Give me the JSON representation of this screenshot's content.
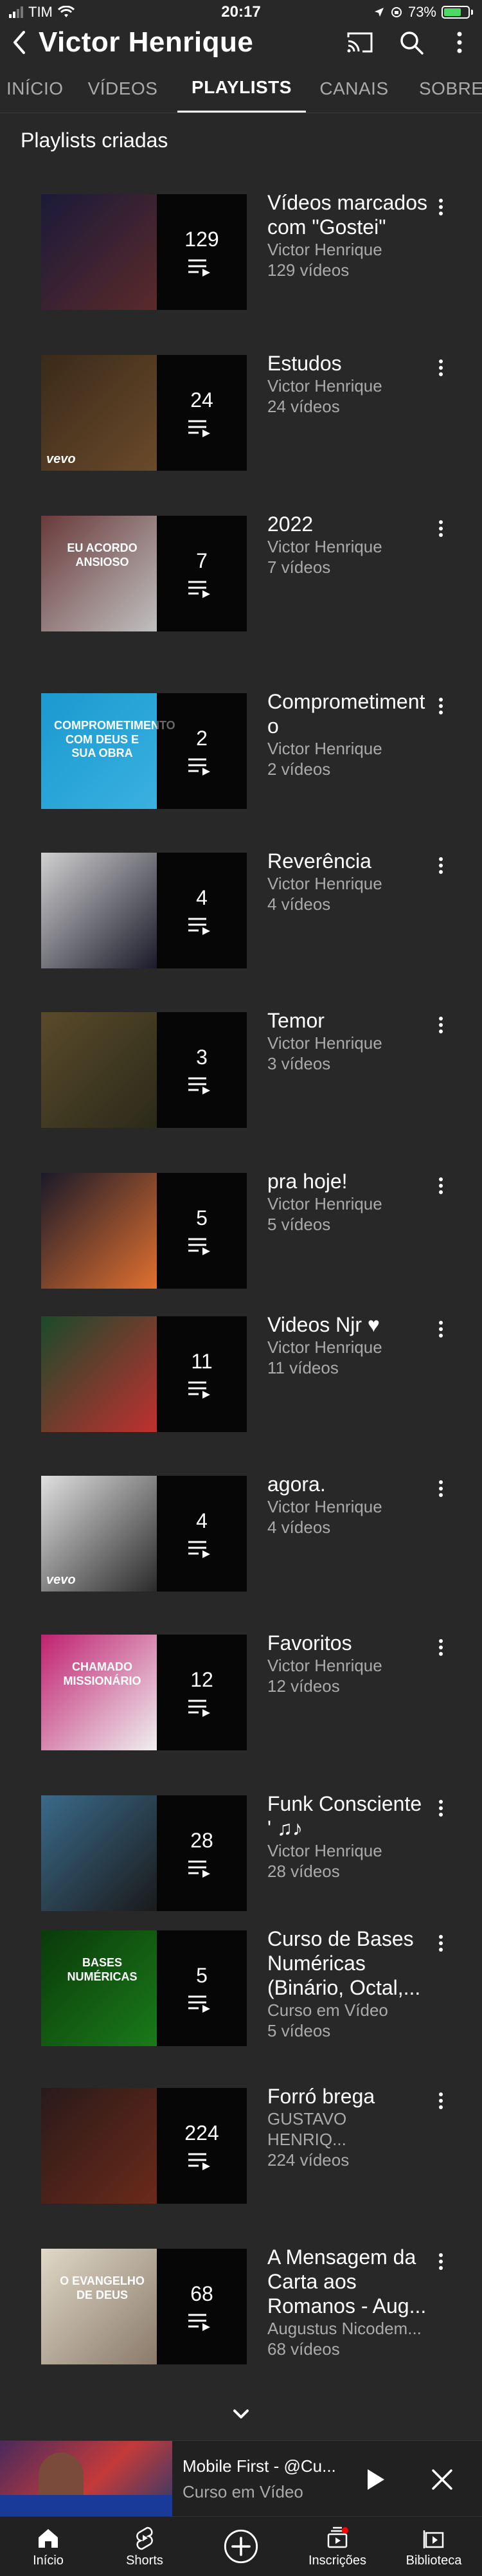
{
  "status_bar": {
    "carrier": "TIM",
    "time": "20:17",
    "battery": "73%"
  },
  "header": {
    "title": "Victor Henrique"
  },
  "tabs": [
    {
      "label": "INÍCIO"
    },
    {
      "label": "VÍDEOS"
    },
    {
      "label": "PLAYLISTS"
    },
    {
      "label": "CANAIS"
    },
    {
      "label": "SOBRE"
    }
  ],
  "section": {
    "title": "Playlists criadas"
  },
  "playlists": [
    {
      "title": "Vídeos marcados com \"Gostei\"",
      "author": "Victor Henrique",
      "videos": "129 vídeos",
      "count": "129",
      "colors": [
        "#1a1a3a",
        "#5a2a2a"
      ],
      "badge": "",
      "caption": ""
    },
    {
      "title": "Estudos",
      "author": "Victor Henrique",
      "videos": "24 vídeos",
      "count": "24",
      "colors": [
        "#3a2a1a",
        "#6a4a2a"
      ],
      "badge": "vevo",
      "caption": ""
    },
    {
      "title": "2022",
      "author": "Victor Henrique",
      "videos": "7 vídeos",
      "count": "7",
      "colors": [
        "#6a3a3a",
        "#c0c0c0"
      ],
      "badge": "",
      "caption": "EU ACORDO ANSIOSO"
    },
    {
      "title": "Comprometimento",
      "author": "Victor Henrique",
      "videos": "2 vídeos",
      "count": "2",
      "colors": [
        "#1a9ad0",
        "#3ab0e0"
      ],
      "badge": "",
      "caption": "COMPROMETIMENTO COM DEUS E SUA OBRA"
    },
    {
      "title": "Reverência",
      "author": "Victor Henrique",
      "videos": "4 vídeos",
      "count": "4",
      "colors": [
        "#d0d0d0",
        "#1a1a2a"
      ],
      "badge": "",
      "caption": ""
    },
    {
      "title": "Temor",
      "author": "Victor Henrique",
      "videos": "3 vídeos",
      "count": "3",
      "colors": [
        "#5a4a2a",
        "#2a2a1a"
      ],
      "badge": "",
      "caption": ""
    },
    {
      "title": "pra hoje!",
      "author": "Victor Henrique",
      "videos": "5 vídeos",
      "count": "5",
      "colors": [
        "#1a1a2a",
        "#e07030"
      ],
      "badge": "",
      "caption": ""
    },
    {
      "title": "Videos Njr ♥",
      "author": "Victor Henrique",
      "videos": "11 vídeos",
      "count": "11",
      "colors": [
        "#1a4a2a",
        "#c03030"
      ],
      "badge": "",
      "caption": ""
    },
    {
      "title": "agora.",
      "author": "Victor Henrique",
      "videos": "4 vídeos",
      "count": "4",
      "colors": [
        "#e0e0e0",
        "#2a2a2a"
      ],
      "badge": "vevo",
      "caption": ""
    },
    {
      "title": "Favoritos",
      "author": "Victor Henrique",
      "videos": "12 vídeos",
      "count": "12",
      "colors": [
        "#c02070",
        "#f0f0f0"
      ],
      "badge": "",
      "caption": "CHAMADO MISSIONÁRIO"
    },
    {
      "title": "Funk Consciente ' ♫♪",
      "author": "Victor Henrique",
      "videos": "28 vídeos",
      "count": "28",
      "colors": [
        "#3a6a8a",
        "#1a1a1a"
      ],
      "badge": "",
      "caption": ""
    },
    {
      "title": "Curso de Bases Numéricas (Binário, Octal,...",
      "author": "Curso em Vídeo",
      "videos": "5 vídeos",
      "count": "5",
      "colors": [
        "#0a3a0a",
        "#1a7a1a"
      ],
      "badge": "",
      "caption": "BASES NUMÉRICAS"
    },
    {
      "title": "Forró brega",
      "author": "GUSTAVO HENRIQ...",
      "videos": "224 vídeos",
      "count": "224",
      "colors": [
        "#2a1a1a",
        "#6a2a1a"
      ],
      "badge": "",
      "caption": ""
    },
    {
      "title": "A Mensagem da Carta aos Romanos - Aug...",
      "author": "Augustus Nicodem...",
      "videos": "68 vídeos",
      "count": "68",
      "colors": [
        "#e0d8c8",
        "#8a7a6a"
      ],
      "badge": "",
      "caption": "O EVANGELHO DE DEUS"
    }
  ],
  "mini_player": {
    "title": "Mobile First  - @Cu...",
    "subtitle": "Curso em Vídeo"
  },
  "bottom_nav": [
    {
      "label": "Início",
      "icon": "home-icon"
    },
    {
      "label": "Shorts",
      "icon": "shorts-icon"
    },
    {
      "label": "",
      "icon": "create-icon"
    },
    {
      "label": "Inscrições",
      "icon": "subscriptions-icon"
    },
    {
      "label": "Biblioteca",
      "icon": "library-icon"
    }
  ],
  "colors": {
    "background": "#282828",
    "text": "#ffffff",
    "secondary": "#aaaaaa",
    "accent_red": "#ff0000",
    "battery_green": "#4cd964"
  }
}
